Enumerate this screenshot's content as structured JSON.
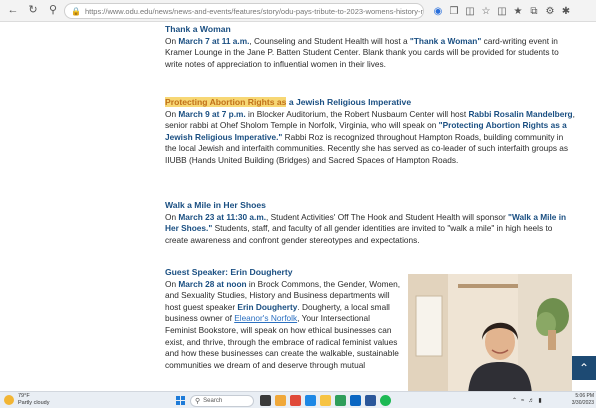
{
  "browser": {
    "url": "https://www.odu.edu/news/news-and-events/features/story/odu-pays-tribute-to-2023-womens-history-month"
  },
  "sections": [
    {
      "title": "Thank a Woman",
      "body": [
        {
          "t": "On "
        },
        {
          "t": "March 7 at 11 a.m.",
          "s": "b"
        },
        {
          "t": ", Counseling and Student Health will host a "
        },
        {
          "t": "\"Thank a Woman\"",
          "s": "b"
        },
        {
          "t": " card-writing event in Kramer Lounge in the Jane P. Batten Student Center. Blank thank you cards will be provided for students to write notes of appreciation to influential women in their lives."
        }
      ]
    },
    {
      "title_highlight": "Protecting Abortion Rights as",
      "title_rest": " a Jewish Religious Imperative",
      "body": [
        {
          "t": "On "
        },
        {
          "t": "March 9 at 7 p.m.",
          "s": "b"
        },
        {
          "t": " in Blocker Auditorium, the Robert Nusbaum Center will host "
        },
        {
          "t": "Rabbi Rosalin Mandelberg",
          "s": "b"
        },
        {
          "t": ", senior rabbi at Ohef Sholom Temple in Norfolk, Virginia, who will speak on "
        },
        {
          "t": "\"Protecting Abortion Rights as a Jewish Religious Imperative.\"",
          "s": "b"
        },
        {
          "t": " Rabbi Roz is recognized throughout Hampton Roads, building community in the local Jewish and interfaith communities. Recently she has served as co-leader of such interfaith groups as IIUBB (Hands United Building (Bridges) and Sacred Spaces of Hampton Roads."
        }
      ]
    },
    {
      "title": "Walk a Mile in Her Shoes",
      "body": [
        {
          "t": "On "
        },
        {
          "t": "March 23 at 11:30 a.m.",
          "s": "b"
        },
        {
          "t": ", Student Activities' Off The Hook and Student Health will sponsor "
        },
        {
          "t": "\"Walk a Mile in Her Shoes.\"",
          "s": "b"
        },
        {
          "t": " Students, staff, and faculty of all gender identities are invited to \"walk a mile\" in high heels to create awareness and confront gender stereotypes and expectations."
        }
      ]
    },
    {
      "title": "Guest Speaker: Erin Dougherty",
      "body": [
        {
          "t": "On "
        },
        {
          "t": "March 28 at noon",
          "s": "b"
        },
        {
          "t": " in Brock Commons, the Gender, Women, and Sexuality Studies, History and Business departments will host guest speaker "
        },
        {
          "t": "Erin Dougherty",
          "s": "b"
        },
        {
          "t": ". Dougherty, a local small business owner of "
        },
        {
          "t": "Eleanor's Norfolk",
          "s": "link"
        },
        {
          "t": ", Your Intersectional Feminist Bookstore, will speak on how ethical businesses can exist, and thrive, through the embrace of radical feminist values and how these businesses can create the walkable, sustainable communities we dream of and deserve through mutual"
        }
      ]
    }
  ],
  "taskbar": {
    "weather_temp": "79°F",
    "weather_desc": "Partly cloudy",
    "search_label": "Search",
    "time": "5:06 PM",
    "date": "3/30/2023"
  },
  "colors": {
    "heading": "#1a4f82",
    "highlight": "#f7d774",
    "link": "#2a6fc0",
    "scroll_button": "#1d4a73"
  }
}
